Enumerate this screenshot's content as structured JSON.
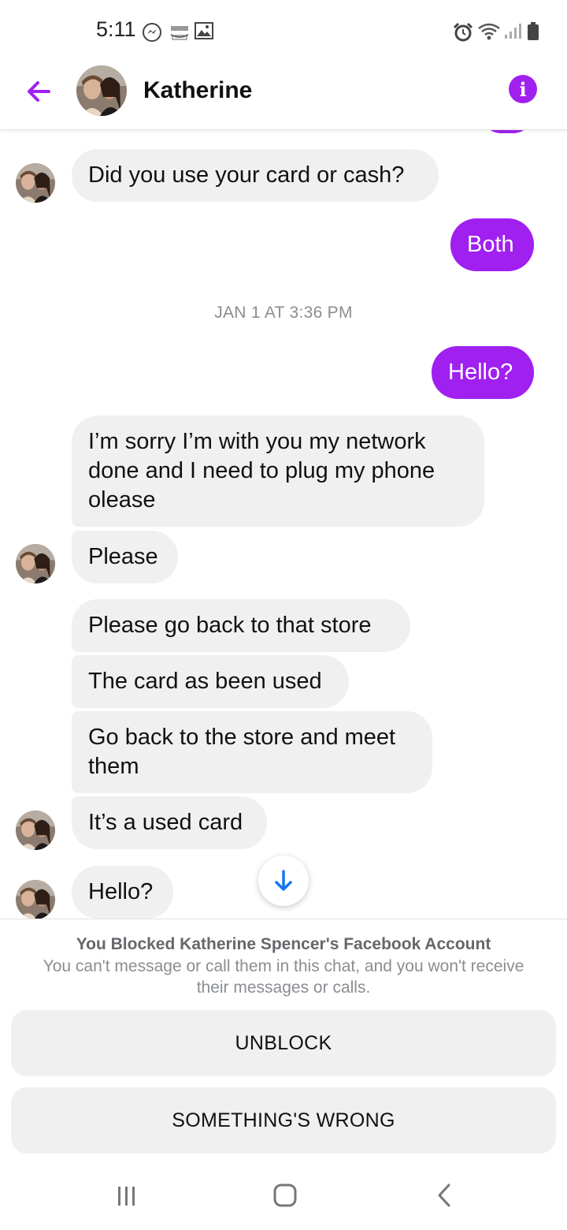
{
  "status_bar": {
    "time": "5:11",
    "left_icons": [
      "messenger-icon",
      "amazon-icon",
      "image-icon"
    ],
    "right_icons": [
      "alarm-icon",
      "wifi-icon",
      "signal-icon",
      "battery-icon"
    ]
  },
  "header": {
    "contact_name": "Katherine",
    "back_icon": "arrow-left-icon",
    "info_icon": "info-icon",
    "accent_color": "#a020f0"
  },
  "messages": [
    {
      "side": "in",
      "text": "Did you use your card or cash?",
      "avatar": true
    },
    {
      "side": "out",
      "text": "Both"
    },
    {
      "type": "timestamp",
      "text": "JAN 1 AT 3:36 PM"
    },
    {
      "side": "out",
      "text": "Hello?"
    },
    {
      "side": "in",
      "text": "I’m sorry I’m with you my network done and I need to plug my phone olease"
    },
    {
      "side": "in",
      "text": "Please",
      "avatar": true
    },
    {
      "side": "in",
      "text": "Please go back to that store"
    },
    {
      "side": "in",
      "text": "The card as been used"
    },
    {
      "side": "in",
      "text": "Go back to the store and meet them"
    },
    {
      "side": "in",
      "text": "It’s a used card",
      "avatar": true
    },
    {
      "side": "in",
      "text": "Hello?",
      "avatar": true
    }
  ],
  "blocked": {
    "title": "You Blocked Katherine Spencer's Facebook Account",
    "description": "You can't message or call them in this chat, and you won't receive their messages or calls.",
    "unblock_label": "UNBLOCK",
    "something_wrong_label": "SOMETHING'S WRONG"
  },
  "nav_bar": {
    "icons": [
      "recent-apps-icon",
      "home-icon",
      "back-icon"
    ]
  }
}
